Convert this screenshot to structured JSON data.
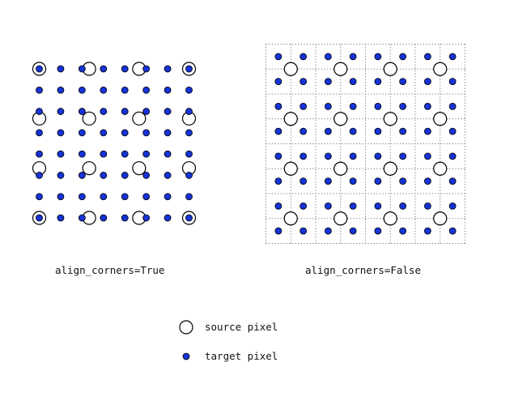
{
  "colors": {
    "target_fill": "#1533d6",
    "stroke": "#000000",
    "source_fill": "#ffffff",
    "grid_line": "#777777"
  },
  "panels": [
    {
      "id": "left",
      "caption": "align_corners=True",
      "source_grid": 4,
      "target_grid": 8,
      "align_corners": true
    },
    {
      "id": "right",
      "caption": "align_corners=False",
      "source_grid": 4,
      "target_grid": 8,
      "align_corners": false,
      "dotted_cell_grid": true
    }
  ],
  "legend": {
    "source_label": "source pixel",
    "target_label": "target pixel"
  }
}
